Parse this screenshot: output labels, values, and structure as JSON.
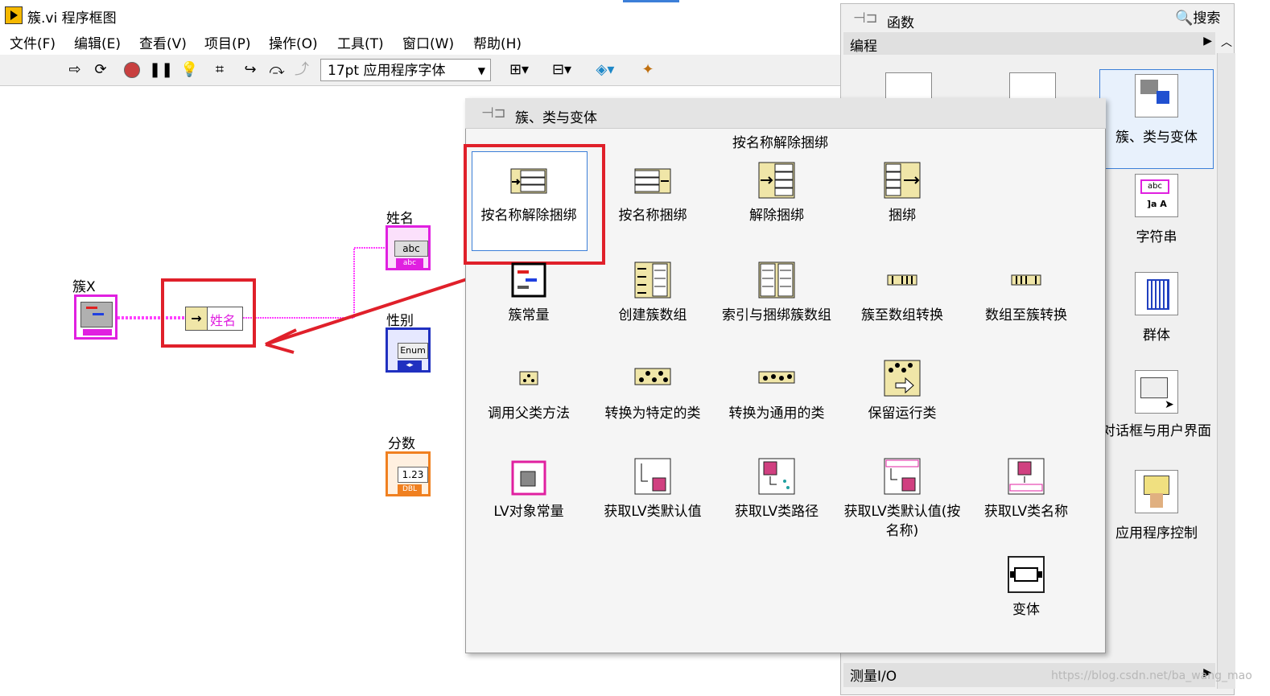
{
  "window": {
    "title": "簇.vi 程序框图"
  },
  "menu": [
    "文件(F)",
    "编辑(E)",
    "查看(V)",
    "项目(P)",
    "操作(O)",
    "工具(T)",
    "窗口(W)",
    "帮助(H)"
  ],
  "toolbar": {
    "icons": [
      "run-arrow-icon",
      "run-continuous-icon",
      "abort-icon",
      "pause-icon",
      "highlight-bulb-icon",
      "retain-wire-icon",
      "step-into-icon",
      "step-over-icon",
      "step-out-icon",
      "align-icon",
      "distribute-icon",
      "reorder-icon",
      "cleanup-icon"
    ],
    "font_select": "17pt 应用程序字体"
  },
  "diagram": {
    "cluster_label": "簇X",
    "unbundle_item": "姓名",
    "indicators": [
      {
        "label": "姓名",
        "type_text": "abc",
        "foot": "abc",
        "color": "#e020e0"
      },
      {
        "label": "性别",
        "type_text": "Enum",
        "foot": "◂▸",
        "color": "#2030c0"
      },
      {
        "label": "分数",
        "type_text": "1.23",
        "foot": "DBL",
        "color": "#f08020"
      }
    ]
  },
  "functions_palette": {
    "pin_title": "函数",
    "search": "搜索",
    "category": "编程",
    "bottom_category": "测量I/O",
    "items": [
      {
        "label": "簇、类与变体"
      },
      {
        "label": "字符串"
      },
      {
        "label": "群体"
      },
      {
        "label": "对话框与用户界面"
      },
      {
        "label": "应用程序控制"
      }
    ]
  },
  "sub_palette": {
    "title": "簇、类与变体",
    "hover_label": "按名称解除捆绑",
    "items": [
      {
        "label": "按名称解除捆绑",
        "icon": "unbundle-by-name-icon"
      },
      {
        "label": "按名称捆绑",
        "icon": "bundle-by-name-icon"
      },
      {
        "label": "解除捆绑",
        "icon": "unbundle-icon"
      },
      {
        "label": "捆绑",
        "icon": "bundle-icon"
      },
      {
        "label": "簇常量",
        "icon": "cluster-constant-icon"
      },
      {
        "label": "创建簇数组",
        "icon": "build-cluster-array-icon"
      },
      {
        "label": "索引与捆绑簇数组",
        "icon": "index-bundle-cluster-array-icon"
      },
      {
        "label": "簇至数组转换",
        "icon": "cluster-to-array-icon"
      },
      {
        "label": "数组至簇转换",
        "icon": "array-to-cluster-icon"
      },
      {
        "label": "调用父类方法",
        "icon": "call-parent-method-icon"
      },
      {
        "label": "转换为特定的类",
        "icon": "to-more-specific-class-icon"
      },
      {
        "label": "转换为通用的类",
        "icon": "to-more-generic-class-icon"
      },
      {
        "label": "保留运行类",
        "icon": "preserve-runtime-class-icon"
      },
      {
        "label": "LV对象常量",
        "icon": "lv-object-constant-icon"
      },
      {
        "label": "获取LV类默认值",
        "icon": "get-lvclass-default-value-icon"
      },
      {
        "label": "获取LV类路径",
        "icon": "get-lvclass-path-icon"
      },
      {
        "label": "获取LV类默认值(按名称)",
        "icon": "get-lvclass-default-by-name-icon"
      },
      {
        "label": "获取LV类名称",
        "icon": "get-lvclass-name-icon"
      },
      {
        "label": "变体",
        "icon": "variant-icon"
      }
    ]
  },
  "watermark": "https://blog.csdn.net/ba_wang_mao",
  "colors": {
    "highlight": "#e0202a",
    "wire_string": "#ff40ff",
    "palette_select": "#3c7fd8"
  }
}
